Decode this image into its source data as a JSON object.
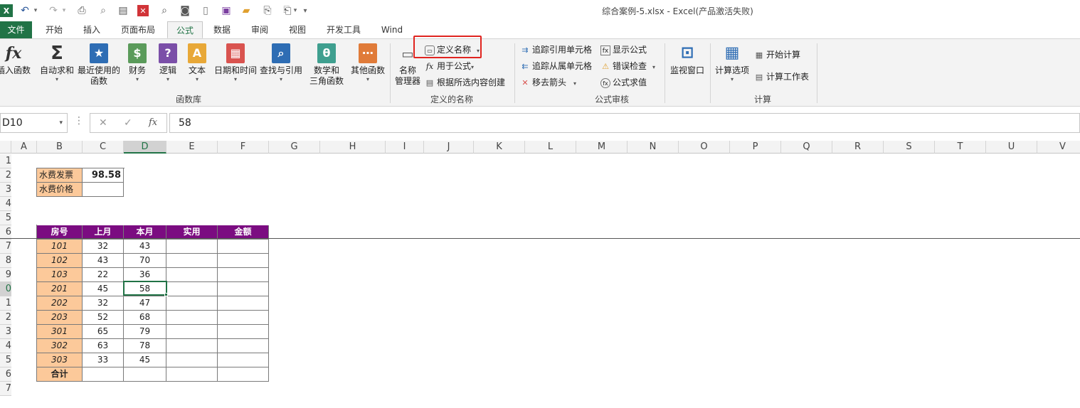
{
  "window": {
    "title": "综合案例-5.xlsx - Excel(产品激活失败)"
  },
  "quick_access": {
    "app_icon": "excel-icon",
    "undo": "↶",
    "redo": "↷",
    "more": "▾"
  },
  "tabs": [
    "文件",
    "开始",
    "插入",
    "页面布局",
    "公式",
    "数据",
    "审阅",
    "视图",
    "开发工具",
    "Wind"
  ],
  "active_tab": "公式",
  "ribbon": {
    "function_library": {
      "label": "函数库",
      "insert_function": "插入函数",
      "autosum": "自动求和",
      "recent": "最近使用的\n函数",
      "financial": "财务",
      "logical": "逻辑",
      "text": "文本",
      "datetime": "日期和时间",
      "lookup": "查找与引用",
      "math": "数学和\n三角函数",
      "more": "其他函数"
    },
    "defined_names": {
      "label": "定义的名称",
      "name_manager": "名称\n管理器",
      "define_name": "定义名称",
      "use_in_formula": "用于公式",
      "create_from_selection": "根据所选内容创建"
    },
    "formula_auditing": {
      "label": "公式审核",
      "trace_precedents": "追踪引用单元格",
      "trace_dependents": "追踪从属单元格",
      "remove_arrows": "移去箭头",
      "show_formulas": "显示公式",
      "error_checking": "错误检查",
      "evaluate_formula": "公式求值",
      "watch_window": "监视窗口"
    },
    "calculation": {
      "label": "计算",
      "calc_options": "计算选项",
      "calc_now": "开始计算",
      "calc_sheet": "计算工作表"
    }
  },
  "formula_bar": {
    "name_box": "D10",
    "cancel": "✕",
    "enter": "✓",
    "fx": "fx",
    "value": "58"
  },
  "columns": [
    "A",
    "B",
    "C",
    "D",
    "E",
    "F",
    "G",
    "H",
    "I",
    "J",
    "K",
    "L",
    "M",
    "N",
    "O",
    "P",
    "Q",
    "R",
    "S",
    "T",
    "U",
    "V"
  ],
  "row_numbers": [
    "1",
    "2",
    "3",
    "4",
    "5",
    "6",
    "7",
    "8",
    "9",
    "0",
    "1",
    "2",
    "3",
    "4",
    "5",
    "6",
    "7"
  ],
  "info_table": [
    {
      "label": "水费发票",
      "value": "98.58"
    },
    {
      "label": "水费价格",
      "value": ""
    }
  ],
  "table": {
    "headers": [
      "房号",
      "上月",
      "本月",
      "实用",
      "金额"
    ],
    "rows": [
      [
        "101",
        "32",
        "43",
        "",
        ""
      ],
      [
        "102",
        "43",
        "70",
        "",
        ""
      ],
      [
        "103",
        "22",
        "36",
        "",
        ""
      ],
      [
        "201",
        "45",
        "58",
        "",
        ""
      ],
      [
        "202",
        "32",
        "47",
        "",
        ""
      ],
      [
        "203",
        "52",
        "68",
        "",
        ""
      ],
      [
        "301",
        "65",
        "79",
        "",
        ""
      ],
      [
        "302",
        "63",
        "78",
        "",
        ""
      ],
      [
        "303",
        "33",
        "45",
        "",
        ""
      ]
    ],
    "total_label": "合计"
  },
  "colors": {
    "accent": "#217346",
    "header_fill": "#7b0c81",
    "room_fill": "#fcc99a",
    "highlight": "#e0241f"
  }
}
